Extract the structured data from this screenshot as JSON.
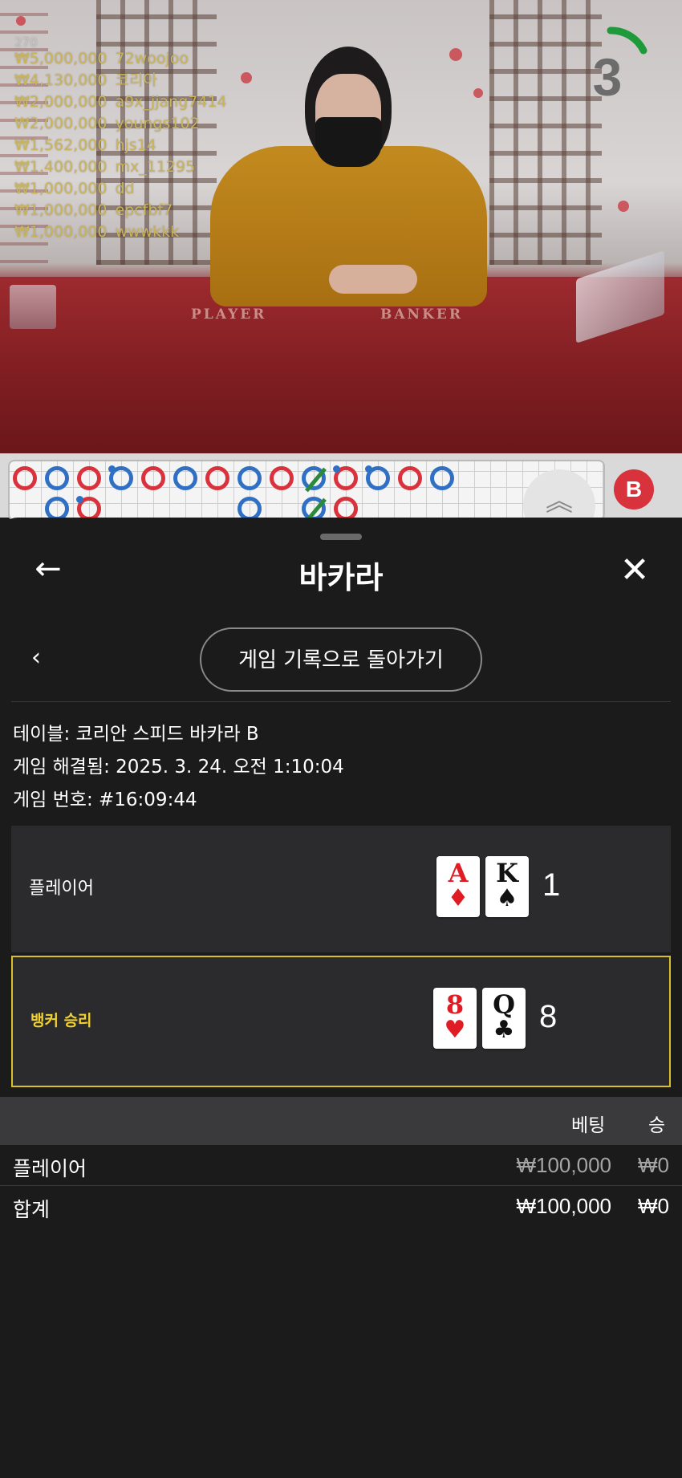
{
  "video": {
    "table_labels": [
      "PLAYER",
      "BANKER"
    ],
    "top_partial_text": "270",
    "countdown": "3",
    "bets": [
      {
        "amount": "₩5,000,000",
        "user": "72woojoo"
      },
      {
        "amount": "₩4,130,000",
        "user": "코리아"
      },
      {
        "amount": "₩2,000,000",
        "user": "a9x_jjang7414"
      },
      {
        "amount": "₩2,000,000",
        "user": "youngs102"
      },
      {
        "amount": "₩1,562,000",
        "user": "hjs14"
      },
      {
        "amount": "₩1,400,000",
        "user": "mx_11295"
      },
      {
        "amount": "₩1,000,000",
        "user": "dd"
      },
      {
        "amount": "₩1,000,000",
        "user": "epcfbf7"
      },
      {
        "amount": "₩1,000,000",
        "user": "wwwkkk"
      }
    ]
  },
  "roadmap": {
    "badge": "B"
  },
  "sheet": {
    "title": "바카라",
    "back_to_history": "게임 기록으로 돌아가기",
    "info": {
      "table": "테이블: 코리안 스피드 바카라 B",
      "resolved": "게임 해결됨: 2025. 3. 24. 오전 1:10:04",
      "number": "게임 번호: #16:09:44"
    },
    "player": {
      "label": "플레이어",
      "cards": [
        {
          "rank": "A",
          "suit": "♦"
        },
        {
          "rank": "K",
          "suit": "♠"
        }
      ],
      "score": "1"
    },
    "banker": {
      "label": "뱅커 승리",
      "cards": [
        {
          "rank": "8",
          "suit": "♥"
        },
        {
          "rank": "Q",
          "suit": "♣"
        }
      ],
      "score": "8"
    },
    "table": {
      "headers": {
        "bet": "베팅",
        "win": "승"
      },
      "rows": [
        {
          "name": "플레이어",
          "bet": "₩100,000",
          "win": "₩0"
        },
        {
          "name": "합계",
          "bet": "₩100,000",
          "win": "₩0"
        }
      ]
    }
  },
  "colors": {
    "accent_yellow": "#f2d233",
    "road_red": "#d8323c",
    "road_blue": "#2f6fc4",
    "road_green": "#2a8a3a",
    "card_red": "#e01b24"
  },
  "icons": [
    "arrow-left-icon",
    "close-icon",
    "chevron-left-icon",
    "chevron-double-up-icon"
  ]
}
